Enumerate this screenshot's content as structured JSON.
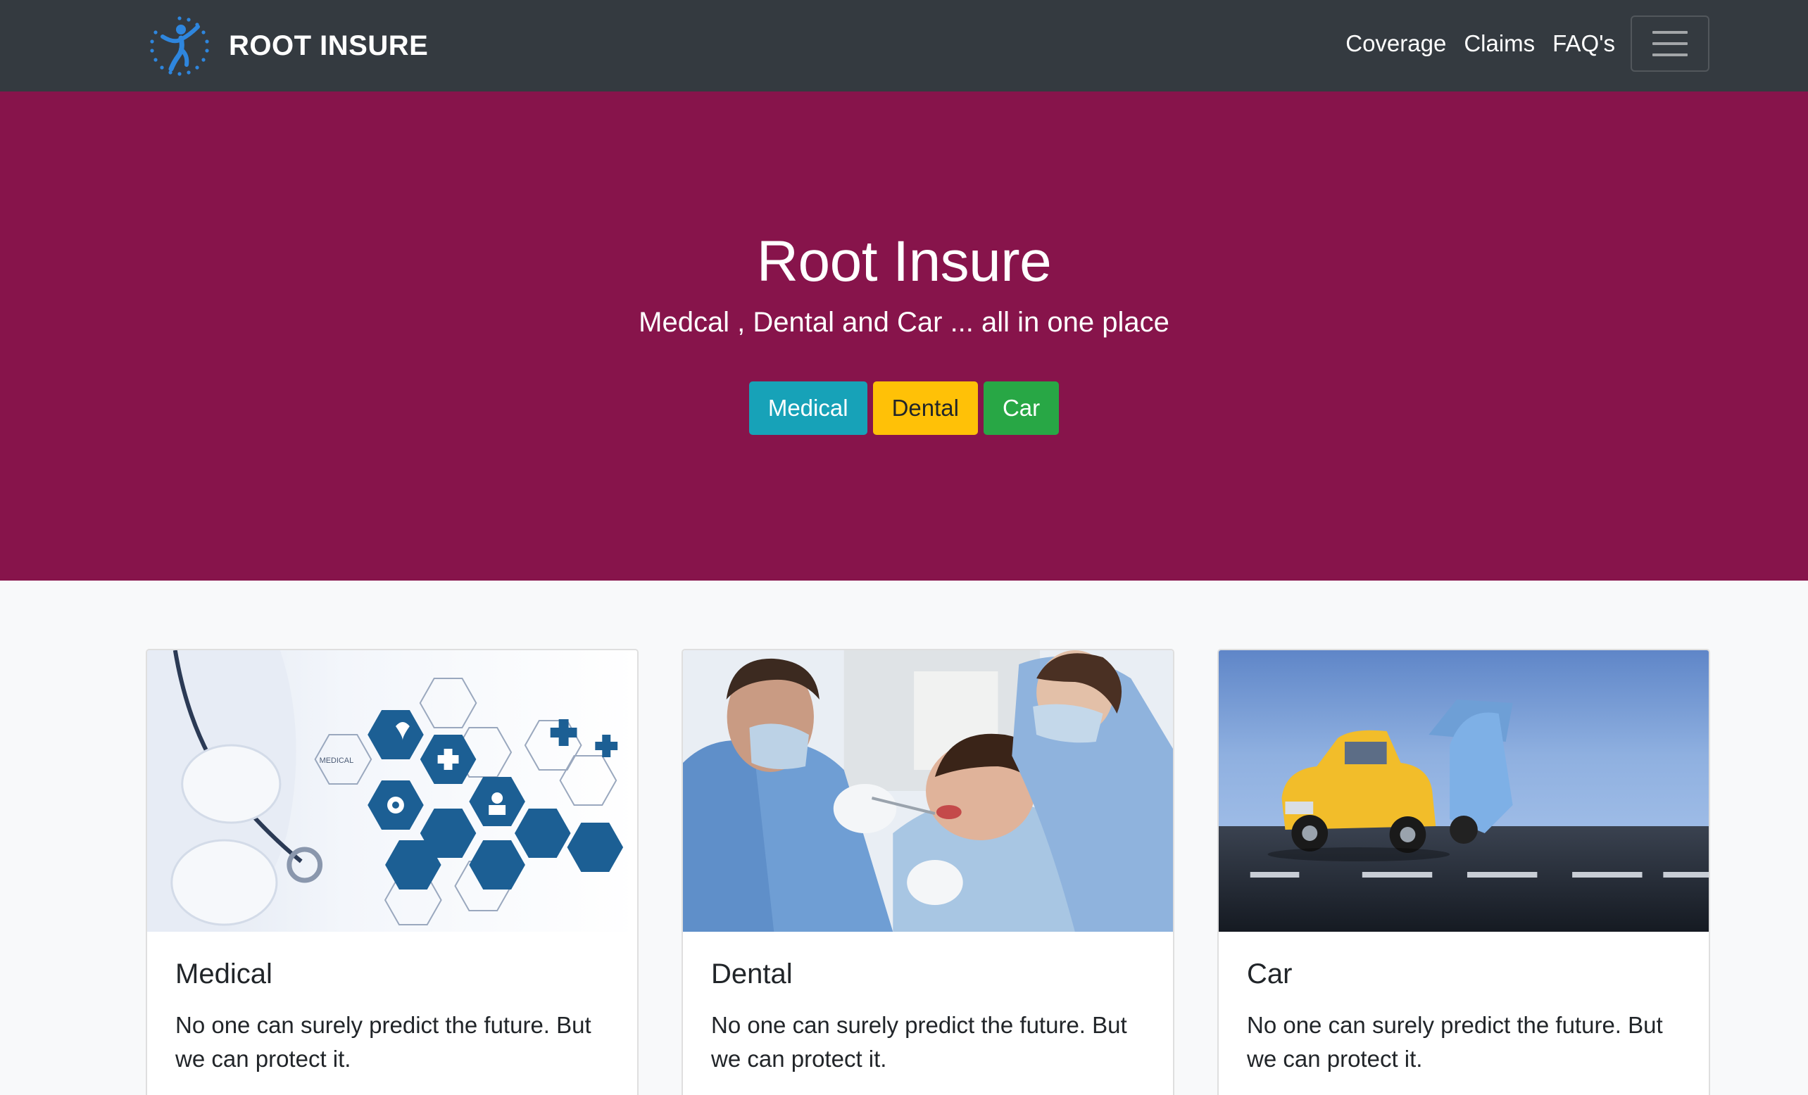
{
  "navbar": {
    "brand": "ROOT INSURE",
    "links": [
      "Coverage",
      "Claims",
      "FAQ's"
    ]
  },
  "hero": {
    "title": "Root Insure",
    "subtitle": "Medcal , Dental and Car ... all in one place",
    "buttons": [
      "Medical",
      "Dental",
      "Car"
    ]
  },
  "cards": [
    {
      "title": "Medical",
      "text": "No one can surely predict the future. But we can protect it.",
      "image": "medical-hexagon-icons-photo"
    },
    {
      "title": "Dental",
      "text": "No one can surely predict the future. But we can protect it.",
      "image": "dentist-patient-photo"
    },
    {
      "title": "Car",
      "text": "No one can surely predict the future. But we can protect it.",
      "image": "toy-car-crash-photo"
    }
  ],
  "colors": {
    "navbar": "#343a40",
    "hero": "#87144b",
    "btn_medical": "#17a2b8",
    "btn_dental": "#ffc107",
    "btn_car": "#28a745",
    "logo": "#2e86de"
  }
}
